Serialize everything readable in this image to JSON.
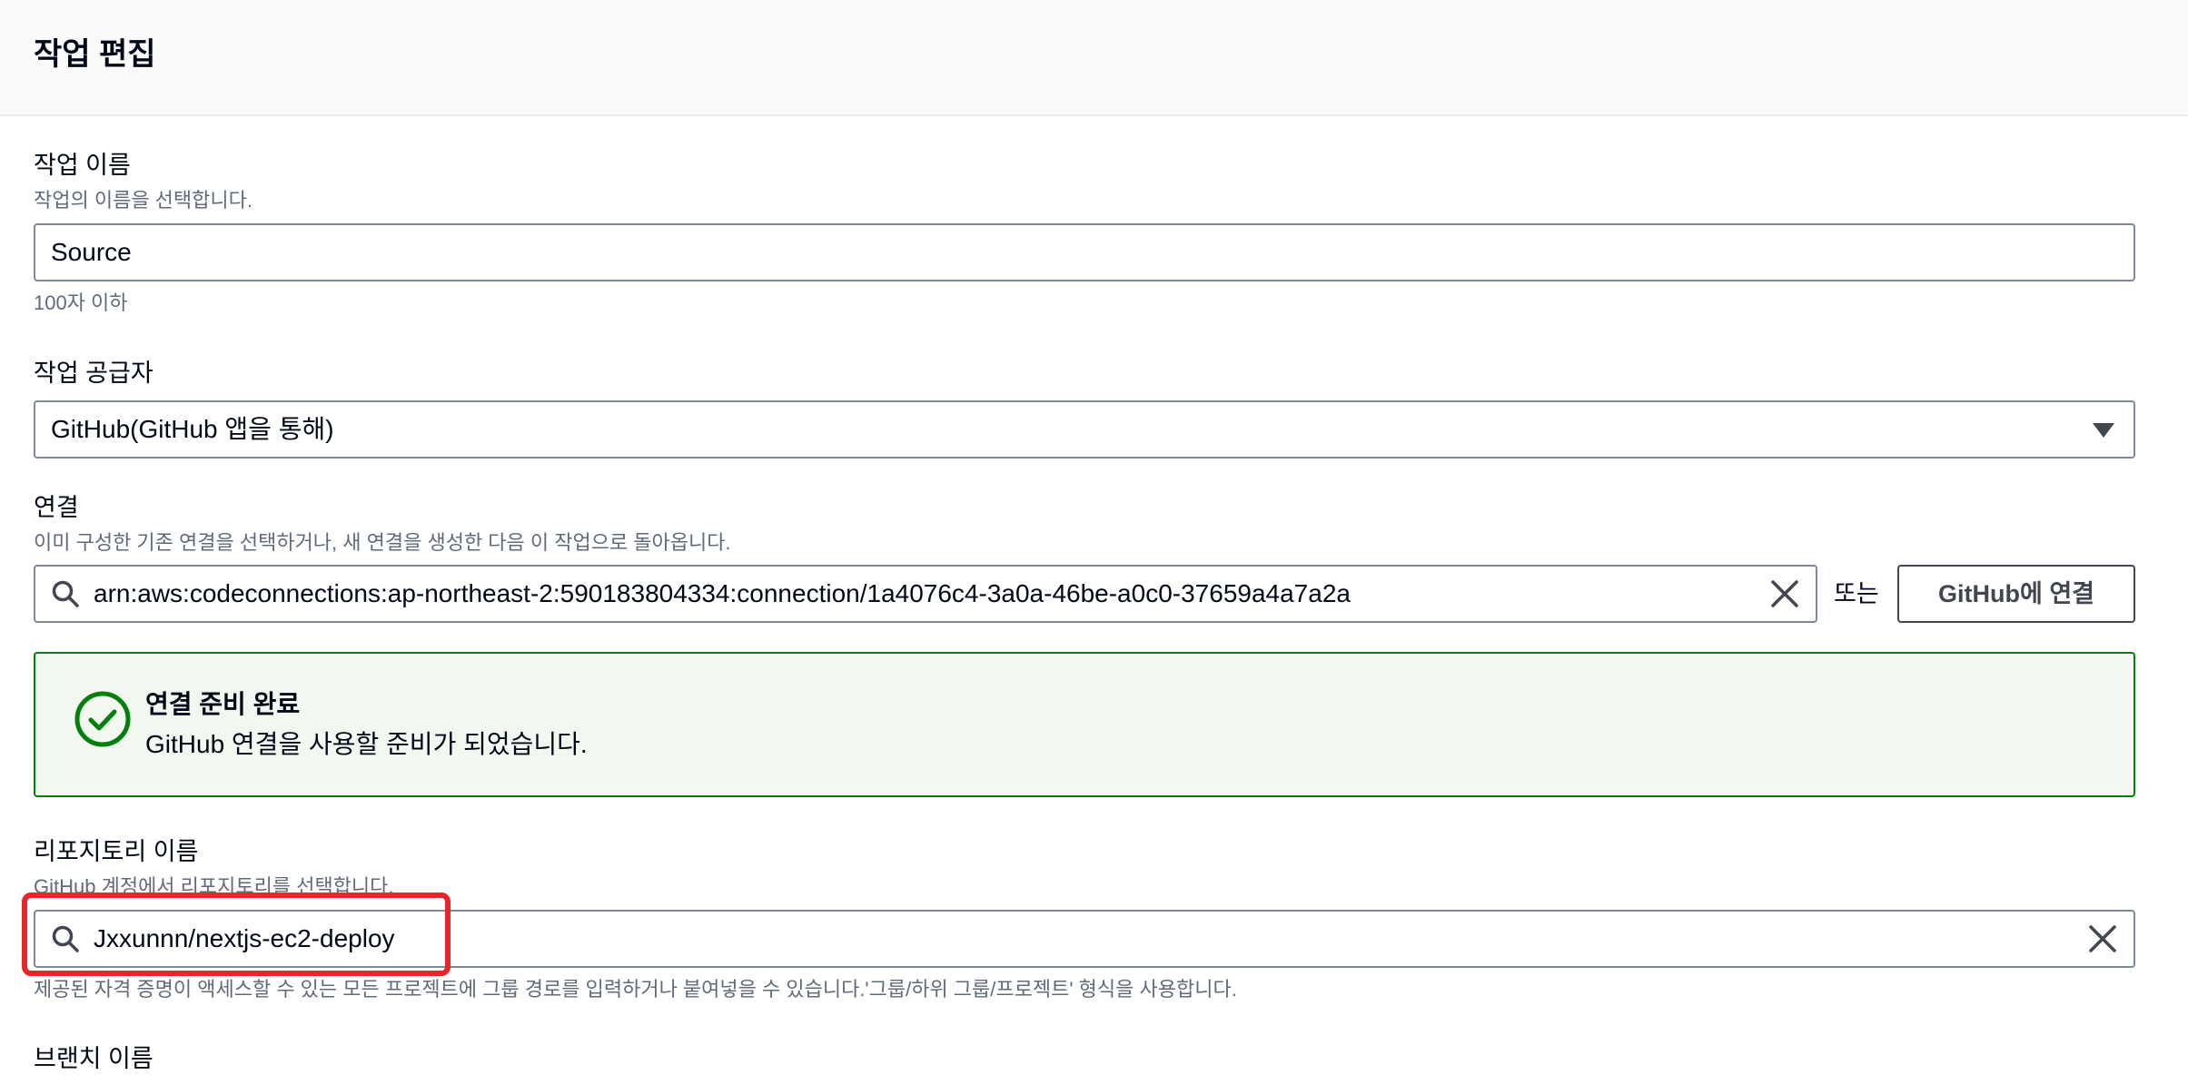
{
  "header": {
    "title": "작업 편집"
  },
  "action_name": {
    "label": "작업 이름",
    "description": "작업의 이름을 선택합니다.",
    "value": "Source",
    "constraint": "100자 이하"
  },
  "action_provider": {
    "label": "작업 공급자",
    "selected": "GitHub(GitHub 앱을 통해)",
    "icon": "caret-down-icon"
  },
  "connection": {
    "label": "연결",
    "description": "이미 구성한 기존 연결을 선택하거나, 새 연결을 생성한 다음 이 작업으로 돌아옵니다.",
    "value": "arn:aws:codeconnections:ap-northeast-2:590183804334:connection/1a4076c4-3a0a-46be-a0c0-37659a4a7a2a",
    "or_text": "또는",
    "connect_button": "GitHub에 연결"
  },
  "alert": {
    "title": "연결 준비 완료",
    "message": "GitHub 연결을 사용할 준비가 되었습니다.",
    "color": "#037f0c"
  },
  "repository": {
    "label": "리포지토리 이름",
    "description": "GitHub 계정에서 리포지토리를 선택합니다.",
    "value": "Jxxunnn/nextjs-ec2-deploy",
    "hint": "제공된 자격 증명이 액세스할 수 있는 모든 프로젝트에 그룹 경로를 입력하거나 붙여넣을 수 있습니다.'그룹/하위 그룹/프로젝트' 형식을 사용합니다."
  },
  "branch": {
    "label": "브랜치 이름"
  },
  "highlight_color": "#e8262a"
}
